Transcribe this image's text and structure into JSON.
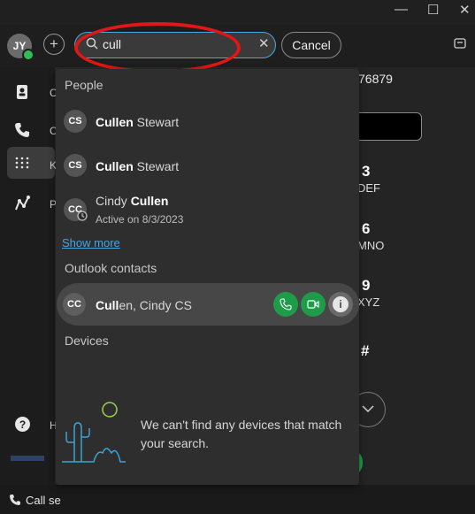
{
  "window": {
    "minimize": "—",
    "maximize": "☐",
    "close": "✕"
  },
  "header": {
    "avatar_initials": "JY",
    "add_symbol": "+",
    "search_value": "cull",
    "search_placeholder": "",
    "cancel_label": "Cancel"
  },
  "sidebar": {
    "items": [
      {
        "icon": "contacts-icon",
        "label": "C"
      },
      {
        "icon": "phone-icon",
        "label": "C"
      },
      {
        "icon": "keypad-icon",
        "label": "K"
      },
      {
        "icon": "analytics-icon",
        "label": "P"
      }
    ],
    "help_label": "H",
    "footer_label": "Call se"
  },
  "right": {
    "number_tail": "76879",
    "key3_num": "3",
    "key3_letters": "DEF",
    "key6_num": "6",
    "key6_letters": "MNO",
    "key9_num": "9",
    "key9_letters": "XYZ",
    "hash": "#"
  },
  "dropdown": {
    "people_heading": "People",
    "people": [
      {
        "initials": "CS",
        "bold": "Cullen",
        "rest": " Stewart",
        "pre": "",
        "status": ""
      },
      {
        "initials": "CS",
        "bold": "Cullen",
        "rest": " Stewart",
        "pre": "",
        "status": ""
      },
      {
        "initials": "CC",
        "bold": "Cullen",
        "rest": "",
        "pre": "Cindy ",
        "status": "Active on 8/3/2023"
      }
    ],
    "show_more": "Show more",
    "outlook_heading": "Outlook contacts",
    "outlook_contact": {
      "initials": "CC",
      "bold": "Cull",
      "rest": "en, Cindy CS"
    },
    "devices_heading": "Devices",
    "devices_empty": "We can't find any devices that match your search."
  },
  "colors": {
    "accent": "#49a9d8",
    "call_green": "#1f9c4a",
    "highlight_red": "#e11616"
  }
}
